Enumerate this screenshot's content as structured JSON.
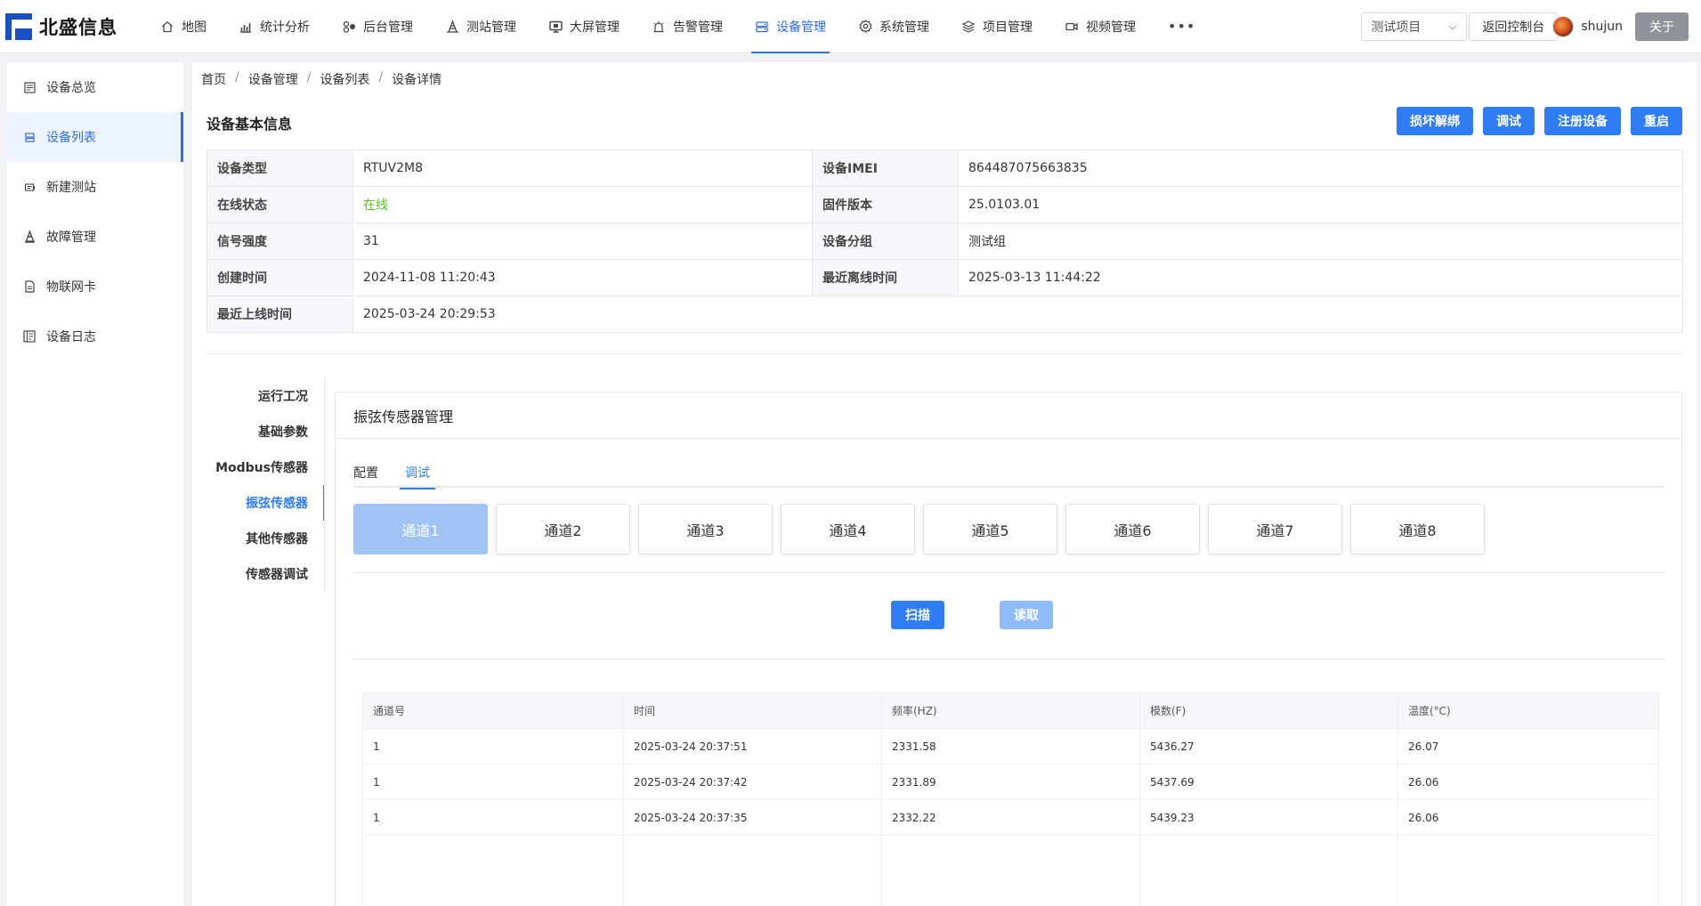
{
  "brand": {
    "name": "北盛信息"
  },
  "nav": [
    {
      "label": "地图",
      "icon": "home-icon"
    },
    {
      "label": "统计分析",
      "icon": "chart-icon"
    },
    {
      "label": "后台管理",
      "icon": "cluster-icon"
    },
    {
      "label": "测站管理",
      "icon": "station-icon"
    },
    {
      "label": "大屏管理",
      "icon": "monitor-icon"
    },
    {
      "label": "告警管理",
      "icon": "alert-icon"
    },
    {
      "label": "设备管理",
      "icon": "device-icon",
      "active": true
    },
    {
      "label": "系统管理",
      "icon": "gear-icon"
    },
    {
      "label": "项目管理",
      "icon": "layers-icon"
    },
    {
      "label": "视频管理",
      "icon": "video-icon"
    }
  ],
  "nav_more": "•••",
  "header": {
    "project_select": "测试项目",
    "console_button": "返回控制台",
    "user_name": "shujun",
    "about_button": "关于"
  },
  "sidebar": [
    {
      "label": "设备总览",
      "icon": "overview-icon"
    },
    {
      "label": "设备列表",
      "icon": "list-icon",
      "active": true
    },
    {
      "label": "新建测站",
      "icon": "new-station-icon"
    },
    {
      "label": "故障管理",
      "icon": "cone-icon"
    },
    {
      "label": "物联网卡",
      "icon": "sim-card-icon"
    },
    {
      "label": "设备日志",
      "icon": "log-icon"
    }
  ],
  "breadcrumb": [
    "首页",
    "设备管理",
    "设备列表",
    "设备详情"
  ],
  "basic_info": {
    "title": "设备基本信息",
    "actions": [
      "损坏解绑",
      "调试",
      "注册设备",
      "重启"
    ],
    "rows": [
      [
        "设备类型",
        "RTUV2M8",
        "设备IMEI",
        "864487075663835"
      ],
      [
        "在线状态",
        "在线",
        "固件版本",
        "25.0103.01"
      ],
      [
        "信号强度",
        "31",
        "设备分组",
        "测试组"
      ],
      [
        "创建时间",
        "2024-11-08 11:20:43",
        "最近离线时间",
        "2025-03-13 11:44:22"
      ],
      [
        "最近上线时间",
        "2025-03-24 20:29:53"
      ]
    ],
    "status_color": "#52c41a"
  },
  "inner_menu": [
    "运行工况",
    "基础参数",
    "Modbus传感器",
    "振弦传感器",
    "其他传感器",
    "传感器调试"
  ],
  "inner_menu_active": 3,
  "card": {
    "title": "振弦传感器管理",
    "tabs": [
      "配置",
      "调试"
    ],
    "active_tab": 1,
    "channels": [
      "通道1",
      "通道2",
      "通道3",
      "通道4",
      "通道5",
      "通道6",
      "通道7",
      "通道8"
    ],
    "active_channel": 0,
    "scan_button": "扫描",
    "read_button": "读取",
    "table": {
      "headers": [
        "通道号",
        "时间",
        "频率(HZ)",
        "模数(F)",
        "温度(°C)"
      ],
      "rows": [
        [
          "1",
          "2025-03-24 20:37:51",
          "2331.58",
          "5436.27",
          "26.07"
        ],
        [
          "1",
          "2025-03-24 20:37:42",
          "2331.89",
          "5437.69",
          "26.06"
        ],
        [
          "1",
          "2025-03-24 20:37:35",
          "2332.22",
          "5439.23",
          "26.06"
        ]
      ]
    }
  },
  "colors": {
    "accent": "#2e7df4",
    "nav_active": "#2e6fe0",
    "about_button": "#909399"
  }
}
